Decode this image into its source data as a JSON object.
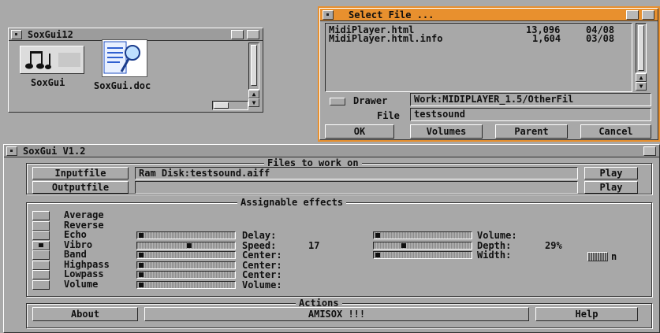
{
  "drawer_window": {
    "title": "SoxGui12",
    "icons": [
      {
        "label": "SoxGui",
        "icon": "music-notes-icon"
      },
      {
        "label": "SoxGui.doc",
        "icon": "document-magnifier-icon"
      }
    ]
  },
  "file_requester": {
    "title": "Select File ...",
    "files": [
      {
        "name": "MidiPlayer.html",
        "size": "13,096",
        "date": "04/08"
      },
      {
        "name": "MidiPlayer.html.info",
        "size": "1,604",
        "date": "03/08"
      }
    ],
    "drawer_label": "Drawer",
    "drawer_value": "Work:MIDIPLAYER_1.5/OtherFil",
    "file_label": "File",
    "file_value": "testsound",
    "buttons": {
      "ok": "OK",
      "volumes": "Volumes",
      "parent": "Parent",
      "cancel": "Cancel"
    }
  },
  "main_window": {
    "title": "SoxGui V1.2",
    "files_group": "Files to work on",
    "inputfile_label": "Inputfile",
    "inputfile_value": "Ram Disk:testsound.aiff",
    "outputfile_label": "Outputfile",
    "outputfile_value": "",
    "play_label": "Play",
    "effects_group": "Assignable effects",
    "effects": [
      {
        "name": "Average",
        "checked": false
      },
      {
        "name": "Reverse",
        "checked": false
      },
      {
        "name": "Echo",
        "checked": false
      },
      {
        "name": "Vibro",
        "checked": true
      },
      {
        "name": "Band",
        "checked": false
      },
      {
        "name": "Highpass",
        "checked": false
      },
      {
        "name": "Lowpass",
        "checked": false
      },
      {
        "name": "Volume",
        "checked": false
      }
    ],
    "param_rows": [
      {
        "slider": 0.0,
        "label": "Delay:",
        "value": "",
        "slider2": 0.0,
        "label2": "Volume:",
        "value2": ""
      },
      {
        "slider": 0.55,
        "label": "Speed:",
        "value": "17",
        "slider2": 0.3,
        "label2": "Depth:",
        "value2": "29%"
      },
      {
        "slider": 0.0,
        "label": "Center:",
        "value": "",
        "slider2": 0.0,
        "label2": "Width:",
        "value2": ""
      },
      {
        "slider": 0.0,
        "label": "Center:",
        "value": ""
      },
      {
        "slider": 0.0,
        "label": "Center:",
        "value": ""
      },
      {
        "slider": 0.0,
        "label": "Volume:",
        "value": ""
      }
    ],
    "width_gadget_label": "n",
    "actions_group": "Actions",
    "about_label": "About",
    "run_label": "AMISOX !!!",
    "help_label": "Help"
  }
}
